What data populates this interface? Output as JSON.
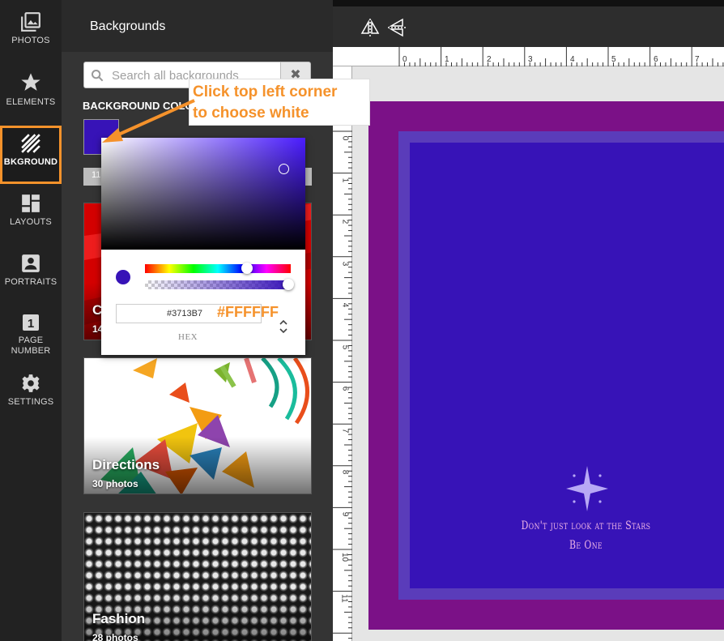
{
  "sidebar": {
    "items": [
      {
        "label": "PHOTOS",
        "icon": "photos-icon"
      },
      {
        "label": "ELEMENTS",
        "icon": "star-icon"
      },
      {
        "label": "BKGROUND",
        "icon": "stripes-icon"
      },
      {
        "label": "LAYOUTS",
        "icon": "layout-icon"
      },
      {
        "label": "PORTRAITS",
        "icon": "portrait-icon"
      },
      {
        "label": "PAGE\nNUMBER",
        "icon": "page-number-icon",
        "badge": "1"
      },
      {
        "label": "SETTINGS",
        "icon": "gear-icon"
      }
    ],
    "active": "BKGROUND"
  },
  "panel": {
    "title": "Backgrounds",
    "search_placeholder": "Search all backgrounds",
    "search_clear": "✖",
    "bg_color_label": "BACKGROUND COLOR",
    "swatch_color": "#3713B7",
    "hidden_strip_text": "11",
    "cards": [
      {
        "name": "C",
        "count": "14"
      },
      {
        "name": "Directions",
        "count": "30 photos"
      },
      {
        "name": "Fashion",
        "count": "28 photos"
      }
    ]
  },
  "ruler": {
    "top": [
      "0",
      "1",
      "2",
      "3",
      "4",
      "5",
      "6",
      "7"
    ],
    "left": [
      "0",
      "1",
      "2",
      "3",
      "4",
      "5",
      "6",
      "7",
      "8",
      "9",
      "10",
      "11"
    ]
  },
  "page": {
    "outer_color": "#7b1187",
    "inner_color": "#3713B7",
    "quote_line1": "Don't just look at the Stars",
    "quote_line2": "Be One"
  },
  "color_picker": {
    "hex_value": "#3713B7",
    "hex_label": "HEX",
    "annotation": "#FFFFFF"
  },
  "callout": {
    "line1": "Click top left corner",
    "line2": "to choose white"
  },
  "colors": {
    "accent": "#f5922b",
    "selected": "#3713B7"
  }
}
